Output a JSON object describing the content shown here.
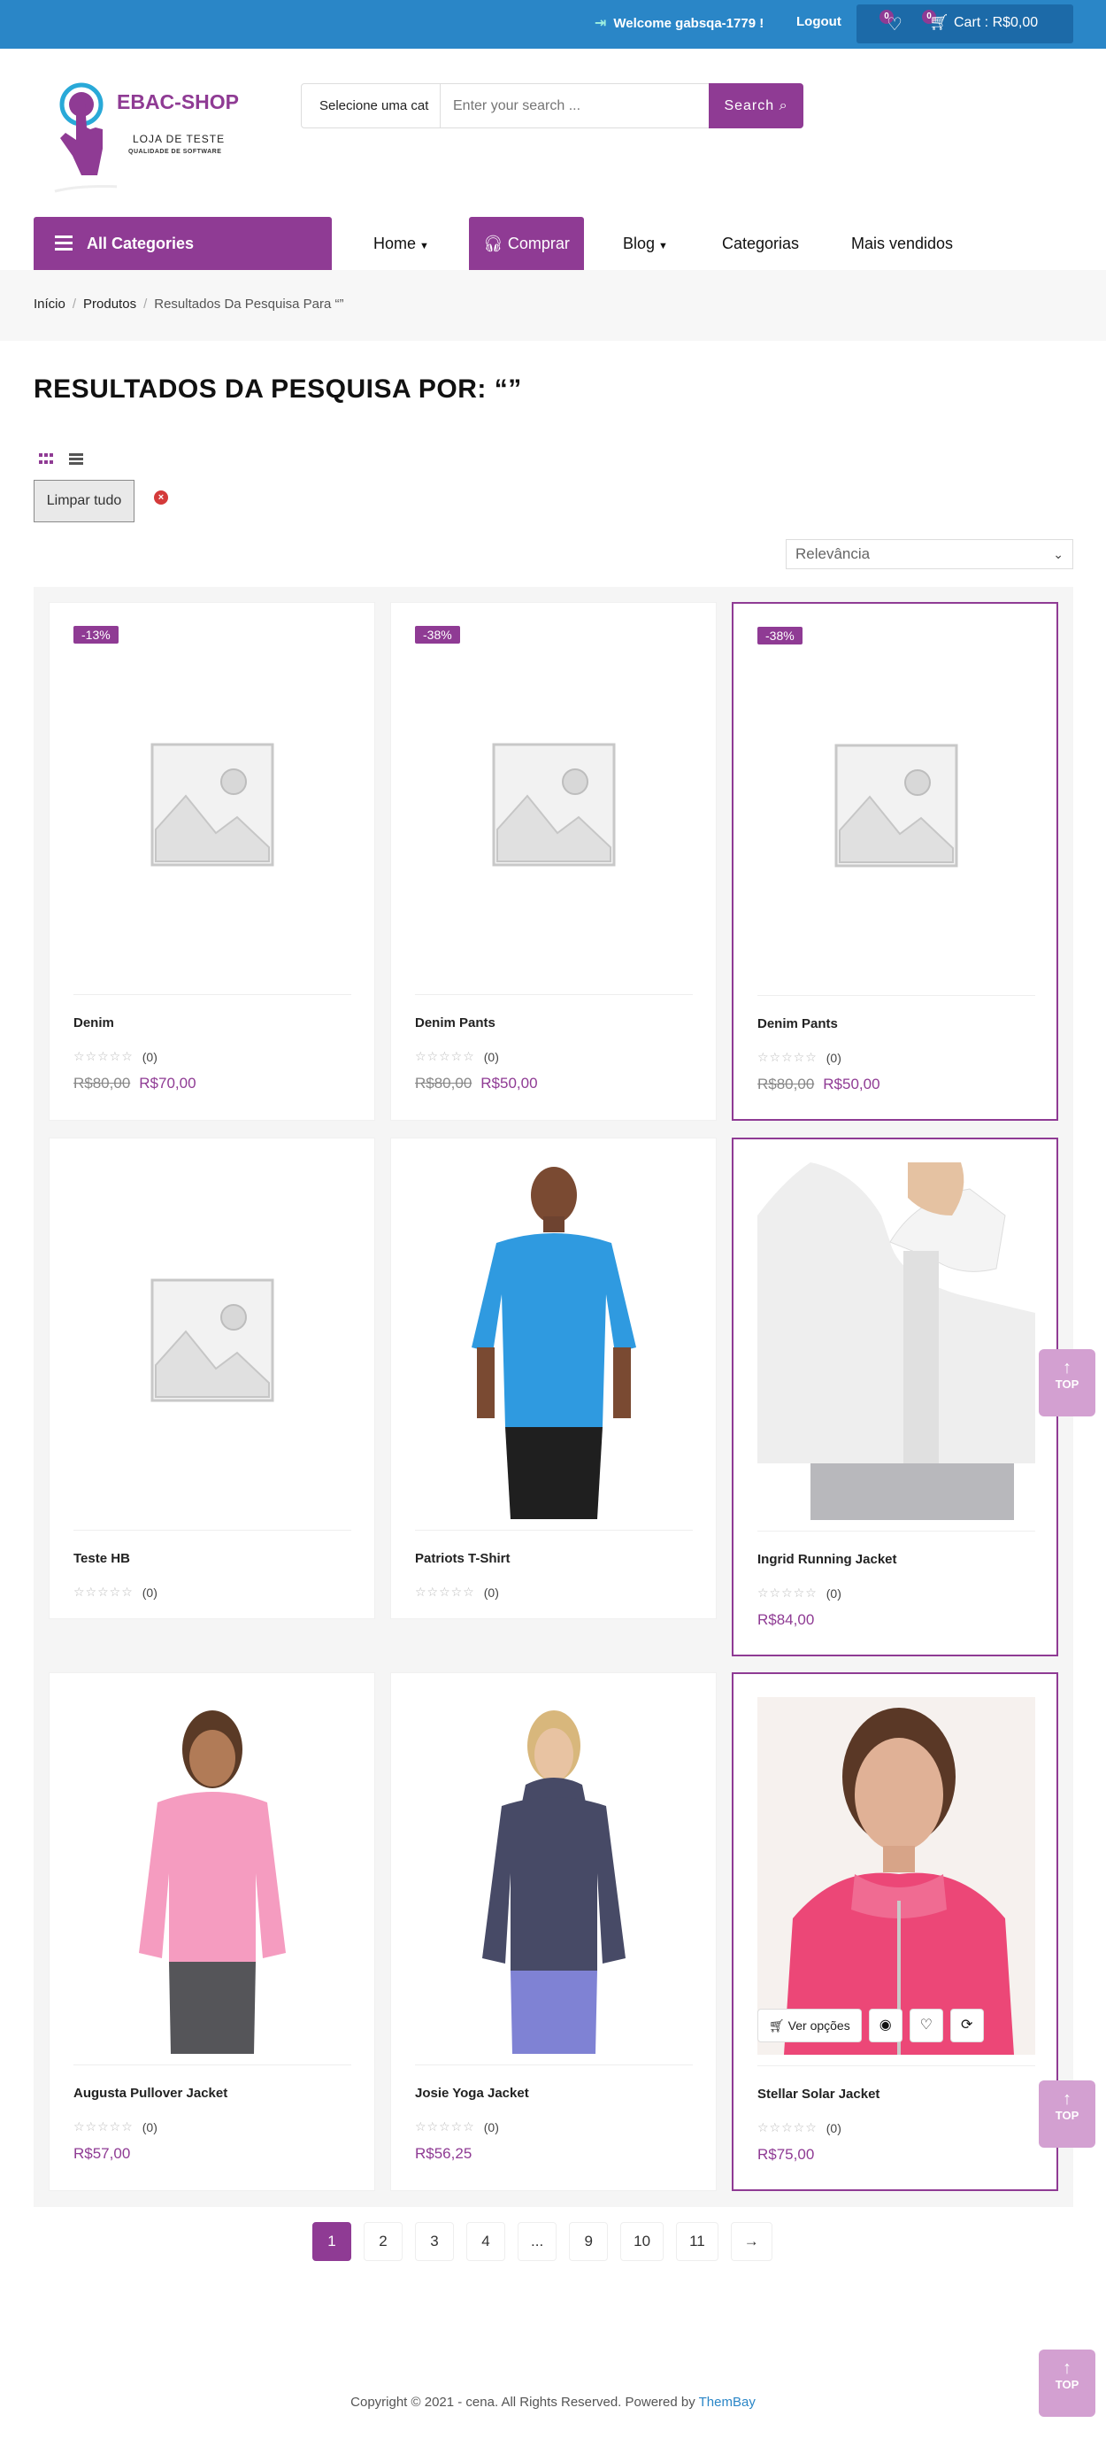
{
  "header": {
    "welcome": "Welcome gabsqa-1779 !",
    "logout": "Logout",
    "wishlist_count": "0",
    "cart_count": "0",
    "cart_label": "Cart : R$0,00"
  },
  "logo": {
    "title": "EBAC-SHOP",
    "line1": "LOJA DE TESTE",
    "line2": "QUALIDADE DE SOFTWARE"
  },
  "search": {
    "category_label": "Selecione uma cat",
    "placeholder": "Enter your search ...",
    "button": "Search"
  },
  "nav": {
    "all_categories": "All Categories",
    "items": [
      "Home",
      "Comprar",
      "Blog",
      "Categorias",
      "Mais vendidos"
    ]
  },
  "breadcrumb": {
    "home": "Início",
    "products": "Produtos",
    "current": "Resultados Da Pesquisa Para “”"
  },
  "page_title": "RESULTADOS DA PESQUISA POR: “”",
  "filters": {
    "clear_all": "Limpar tudo",
    "sort": "Relevância"
  },
  "products": [
    {
      "name": "Denim",
      "sale": "-13%",
      "old_price": "R$80,00",
      "price": "R$70,00",
      "rating_count": "(0)",
      "image": "placeholder"
    },
    {
      "name": "Denim Pants",
      "sale": "-38%",
      "old_price": "R$80,00",
      "price": "R$50,00",
      "rating_count": "(0)",
      "image": "placeholder"
    },
    {
      "name": "Denim Pants",
      "sale": "-38%",
      "old_price": "R$80,00",
      "price": "R$50,00",
      "rating_count": "(0)",
      "image": "placeholder"
    },
    {
      "name": "Teste HB",
      "sale": "",
      "old_price": "",
      "price": "",
      "rating_count": "(0)",
      "image": "placeholder"
    },
    {
      "name": "Patriots T-Shirt",
      "sale": "",
      "old_price": "",
      "price": "",
      "rating_count": "(0)",
      "image": "blue-tshirt-photo"
    },
    {
      "name": "Ingrid Running Jacket",
      "sale": "",
      "old_price": "",
      "price": "R$84,00",
      "rating_count": "(0)",
      "image": "white-jacket-photo"
    },
    {
      "name": "Augusta Pullover Jacket",
      "sale": "",
      "old_price": "",
      "price": "R$57,00",
      "rating_count": "(0)",
      "image": "pink-pullover-photo"
    },
    {
      "name": "Josie Yoga Jacket",
      "sale": "",
      "old_price": "",
      "price": "R$56,25",
      "rating_count": "(0)",
      "image": "navy-jacket-photo"
    },
    {
      "name": "Stellar Solar Jacket",
      "sale": "",
      "old_price": "",
      "price": "R$75,00",
      "rating_count": "(0)",
      "image": "red-jacket-photo"
    }
  ],
  "quick_actions": {
    "options": "Ver opções"
  },
  "to_top": "TOP",
  "pagination": [
    "1",
    "2",
    "3",
    "4",
    "...",
    "9",
    "10",
    "11",
    "→"
  ],
  "footer": {
    "text": "Copyright © 2021 - cena. All Rights Reserved. Powered by",
    "link": "ThemBay"
  },
  "colors": {
    "primary": "#8f3b94",
    "topbar": "#2a86c7"
  }
}
